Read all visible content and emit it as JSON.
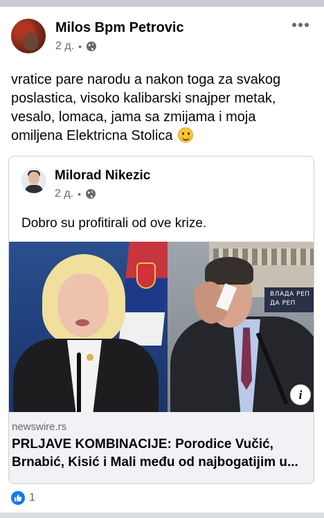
{
  "post": {
    "author": "Milos Bpm Petrovic",
    "time": "2 д.",
    "separator": "•",
    "audience_icon": "globe-icon",
    "more_icon": "more-options-icon",
    "text": "vratice pare narodu a nakon toga za svakog poslastica, visoko kalibarski snajper metak, vesalo, lomaca, jama sa zmijama i moja omiljena Elektricna Stolica",
    "emoji": "smiling-face-icon"
  },
  "shared_post": {
    "author": "Milorad Nikezic",
    "time": "2 д.",
    "separator": "•",
    "audience_icon": "globe-icon",
    "text": "Dobro su profitirali od ove krize."
  },
  "link": {
    "sign_line1": "ВЛАДА РЕП",
    "sign_line2": "ДА РЕП",
    "info_label": "i",
    "domain": "newswire.rs",
    "title": "PRLJAVE KOMBINACIJE: Porodice Vučić, Brnabić, Kisić i Mali među od najbogatijim u..."
  },
  "reactions": {
    "icon": "like-icon",
    "count": "1"
  },
  "colors": {
    "brand_blue": "#1877f2",
    "secondary_text": "#65676b",
    "link_footer_bg": "#f0f2f5"
  }
}
